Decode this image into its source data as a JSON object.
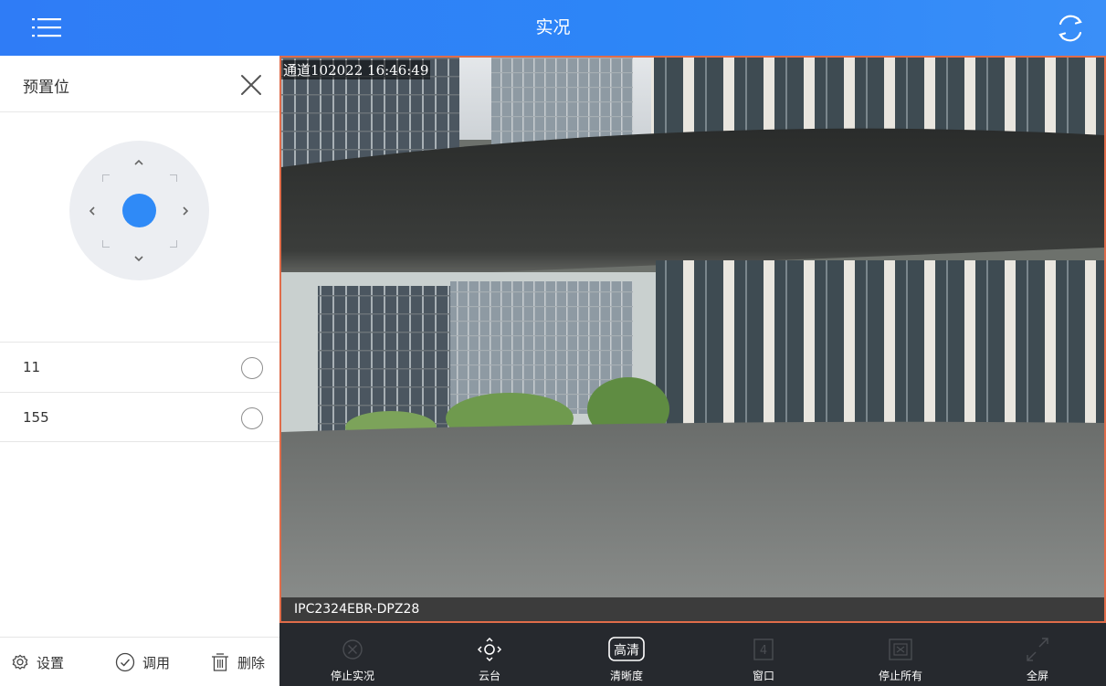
{
  "header": {
    "title": "实况",
    "menu_icon": "menu-list-icon",
    "refresh_icon": "refresh-icon",
    "background": "#2f7cf6"
  },
  "preset_panel": {
    "title": "预置位",
    "close_icon": "close-icon",
    "ptz_center_color": "#2f8af7",
    "presets": [
      {
        "name": "11",
        "selected": false
      },
      {
        "name": "155",
        "selected": false
      }
    ],
    "footer": {
      "settings_label": "设置",
      "call_label": "调用",
      "delete_label": "删除"
    }
  },
  "video": {
    "osd_text": "通道102022 16:46:49",
    "device_name": "IPC2324EBR-DPZ28",
    "border_color": "#e06c4a"
  },
  "toolbar": {
    "items": [
      {
        "label": "停止实况",
        "icon": "stop-live-icon",
        "enabled": false
      },
      {
        "label": "云台",
        "icon": "ptz-control-icon",
        "enabled": true
      },
      {
        "label": "清晰度",
        "icon": "definition-icon",
        "enabled": true,
        "badge": "高清"
      },
      {
        "label": "窗口",
        "icon": "window-layout-icon",
        "enabled": false,
        "badge": "4"
      },
      {
        "label": "停止所有",
        "icon": "stop-all-icon",
        "enabled": false
      },
      {
        "label": "全屏",
        "icon": "fullscreen-icon",
        "enabled": false
      }
    ]
  }
}
